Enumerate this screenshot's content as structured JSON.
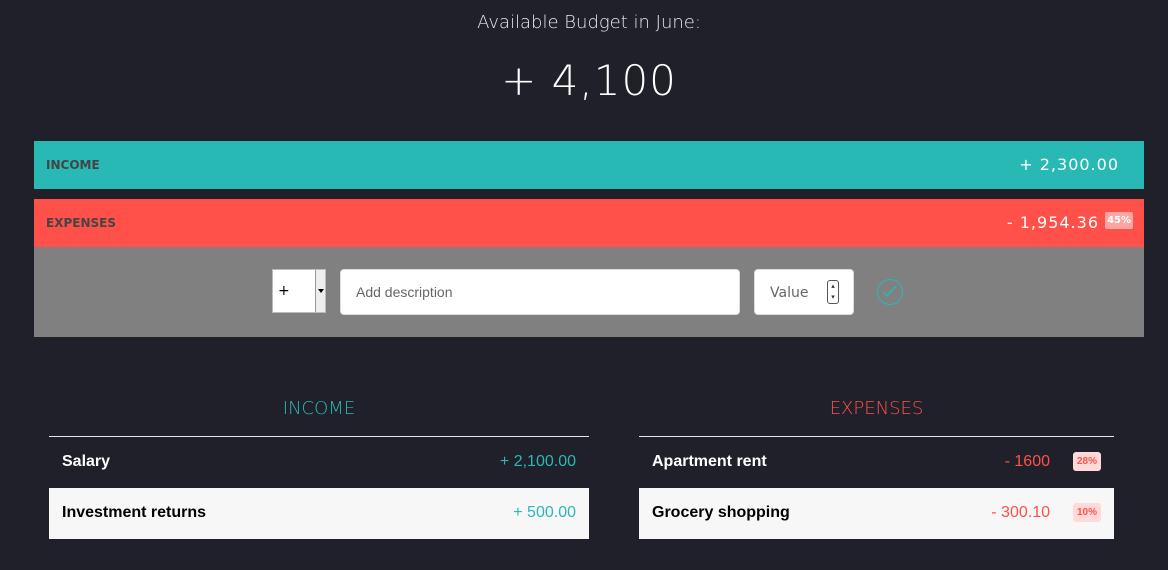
{
  "header": {
    "title": "Available Budget in June:",
    "value": "+ 4,100"
  },
  "summary": {
    "income": {
      "label": "INCOME",
      "value": "+ 2,300.00"
    },
    "expenses": {
      "label": "EXPENSES",
      "value": "- 1,954.36",
      "percentage": "45%"
    }
  },
  "add_form": {
    "type_selected": "+",
    "description_placeholder": "Add description",
    "value_placeholder": "Value",
    "submit_icon": "check-circle-icon"
  },
  "income_list": {
    "title": "INCOME",
    "items": [
      {
        "description": "Salary",
        "value": "+ 2,100.00"
      },
      {
        "description": "Investment returns",
        "value": "+ 500.00"
      }
    ]
  },
  "expenses_list": {
    "title": "EXPENSES",
    "items": [
      {
        "description": "Apartment rent",
        "value": "- 1600",
        "percentage": "28%"
      },
      {
        "description": "Grocery shopping",
        "value": "- 300.10",
        "percentage": "10%"
      }
    ]
  },
  "colors": {
    "background": "#20202a",
    "income": "#28b9b5",
    "expenses": "#ff5049",
    "panel": "#808080"
  }
}
